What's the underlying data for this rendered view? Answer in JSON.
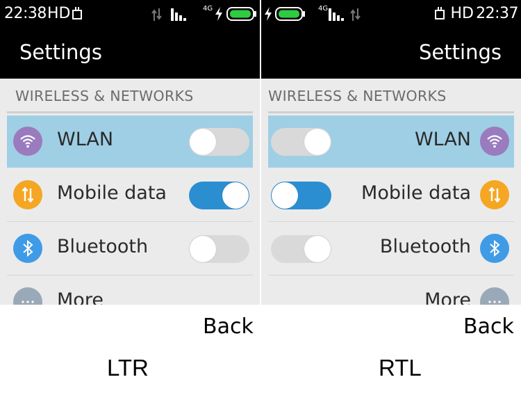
{
  "panels": {
    "ltr": {
      "status": {
        "time": "22:38",
        "hd": "HD",
        "network": "4G"
      },
      "title": "Settings",
      "section_header": "WIRELESS & NETWORKS",
      "items": [
        {
          "label": "WLAN",
          "icon": "wifi-icon",
          "icon_color": "#9a7bbd",
          "toggle_on": false,
          "selected": true
        },
        {
          "label": "Mobile data",
          "icon": "mobile-data-icon",
          "icon_color": "#f5a623",
          "toggle_on": true,
          "selected": false
        },
        {
          "label": "Bluetooth",
          "icon": "bluetooth-icon",
          "icon_color": "#3f9be6",
          "toggle_on": false,
          "selected": false
        },
        {
          "label": "More",
          "icon": "more-icon",
          "icon_color": "#9aa9b8"
        }
      ],
      "back_label": "Back",
      "caption": "LTR"
    },
    "rtl": {
      "status": {
        "time": "22:37",
        "hd": "HD",
        "network": "4G"
      },
      "title": "Settings",
      "section_header": "WIRELESS & NETWORKS",
      "items": [
        {
          "label": "WLAN",
          "icon": "wifi-icon",
          "icon_color": "#9a7bbd",
          "toggle_on": false,
          "selected": true
        },
        {
          "label": "Mobile data",
          "icon": "mobile-data-icon",
          "icon_color": "#f5a623",
          "toggle_on": true,
          "selected": false
        },
        {
          "label": "Bluetooth",
          "icon": "bluetooth-icon",
          "icon_color": "#3f9be6",
          "toggle_on": false,
          "selected": false
        },
        {
          "label": "More",
          "icon": "more-icon",
          "icon_color": "#9aa9b8"
        }
      ],
      "back_label": "Back",
      "caption": "RTL"
    }
  },
  "colors": {
    "selected_row": "#9fcfe5",
    "toggle_on": "#2a8ed1",
    "toggle_off": "#d9d9d9",
    "battery": "#2ecc40"
  }
}
